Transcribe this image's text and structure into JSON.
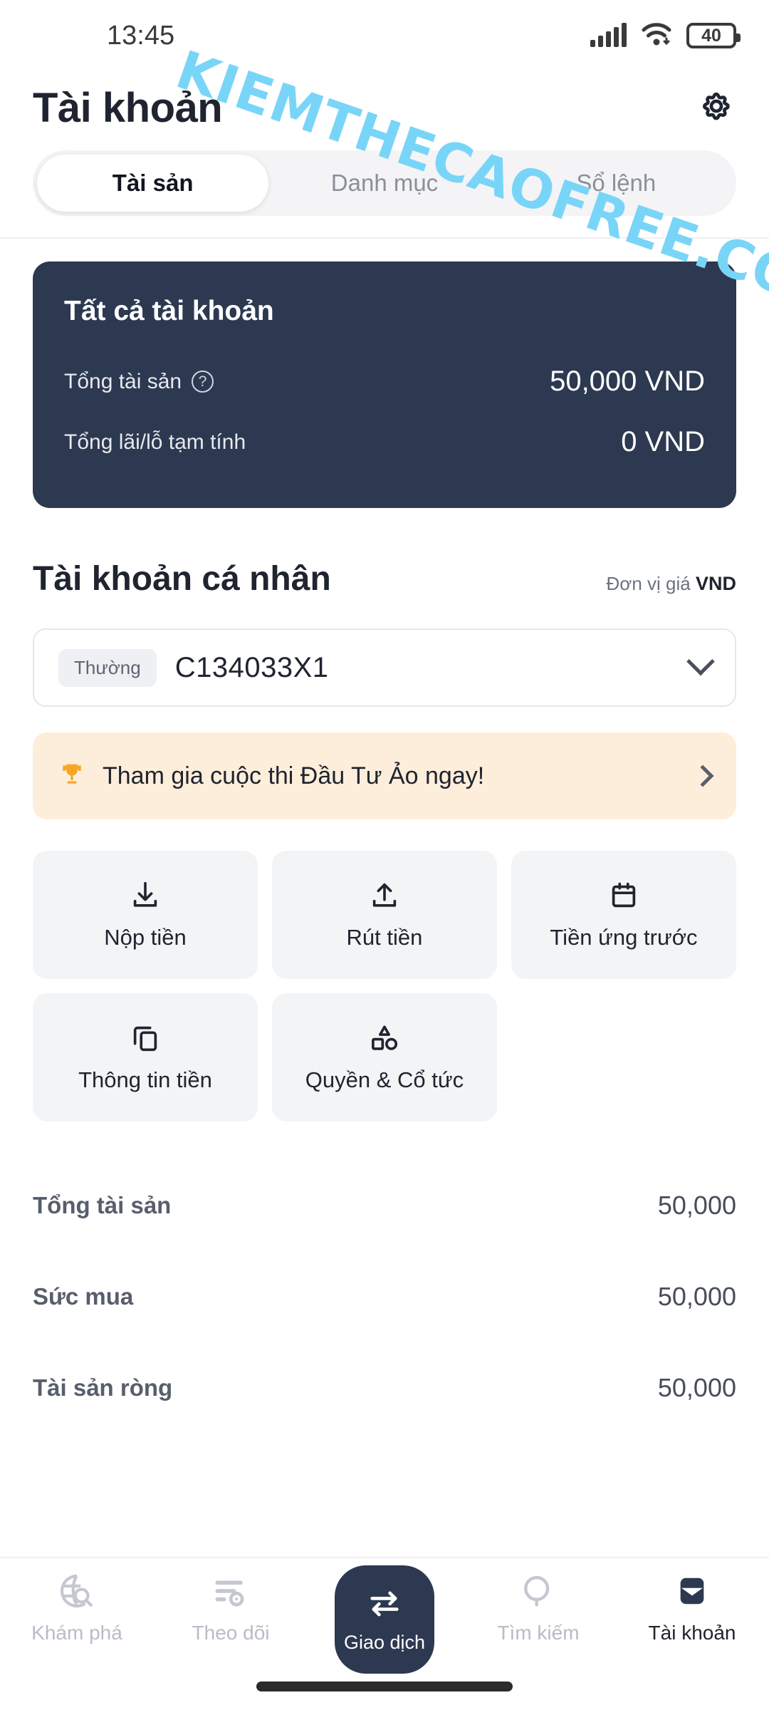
{
  "watermark": {
    "text": "KIEMTHECAOFREE.COM",
    "color": "#79d5f7"
  },
  "status_bar": {
    "time": "13:45",
    "battery_level": "40",
    "signal_icon": "signal-bars-icon",
    "wifi_icon": "wifi-icon",
    "battery_icon": "battery-icon"
  },
  "header": {
    "title": "Tài khoản",
    "settings_icon": "gear-icon"
  },
  "tabs": [
    {
      "label": "Tài sản",
      "active": true
    },
    {
      "label": "Danh mục",
      "active": false
    },
    {
      "label": "Sổ lệnh",
      "active": false
    }
  ],
  "summary_card": {
    "title": "Tất cả tài khoản",
    "background": "#2d3950",
    "rows": [
      {
        "label": "Tổng tài sản",
        "value": "50,000 VND",
        "has_help_icon": true
      },
      {
        "label": "Tổng lãi/lỗ tạm tính",
        "value": "0 VND",
        "has_help_icon": false
      }
    ]
  },
  "account_section": {
    "title": "Tài khoản cá nhân",
    "price_unit_label": "Đơn vị giá",
    "price_unit_value": "VND",
    "selector": {
      "badge": "Thường",
      "account_number": "C134033X1",
      "chevron_icon": "chevron-down-icon"
    }
  },
  "promo": {
    "icon": "trophy-icon",
    "text": "Tham gia cuộc thi Đầu Tư Ảo ngay!",
    "chevron_icon": "chevron-right-icon",
    "background": "#fdeedb"
  },
  "actions": [
    {
      "label": "Nộp tiền",
      "icon": "download-icon"
    },
    {
      "label": "Rút tiền",
      "icon": "upload-icon"
    },
    {
      "label": "Tiền ứng trước",
      "icon": "calendar-icon"
    },
    {
      "label": "Thông tin tiền",
      "icon": "copy-icon"
    },
    {
      "label": "Quyền & Cổ tức",
      "icon": "shapes-icon"
    }
  ],
  "stats": [
    {
      "label": "Tổng tài sản",
      "value": "50,000"
    },
    {
      "label": "Sức mua",
      "value": "50,000"
    },
    {
      "label": "Tài sản ròng",
      "value": "50,000"
    }
  ],
  "bottom_nav": [
    {
      "label": "Khám phá",
      "icon": "explore-globe-search-icon",
      "active": false
    },
    {
      "label": "Theo dõi",
      "icon": "watchlist-icon",
      "active": false
    },
    {
      "label": "Giao dịch",
      "icon": "swap-arrows-icon",
      "active": false,
      "center": true
    },
    {
      "label": "Tìm kiếm",
      "icon": "search-icon",
      "active": false
    },
    {
      "label": "Tài khoản",
      "icon": "wallet-icon",
      "active": true
    }
  ]
}
